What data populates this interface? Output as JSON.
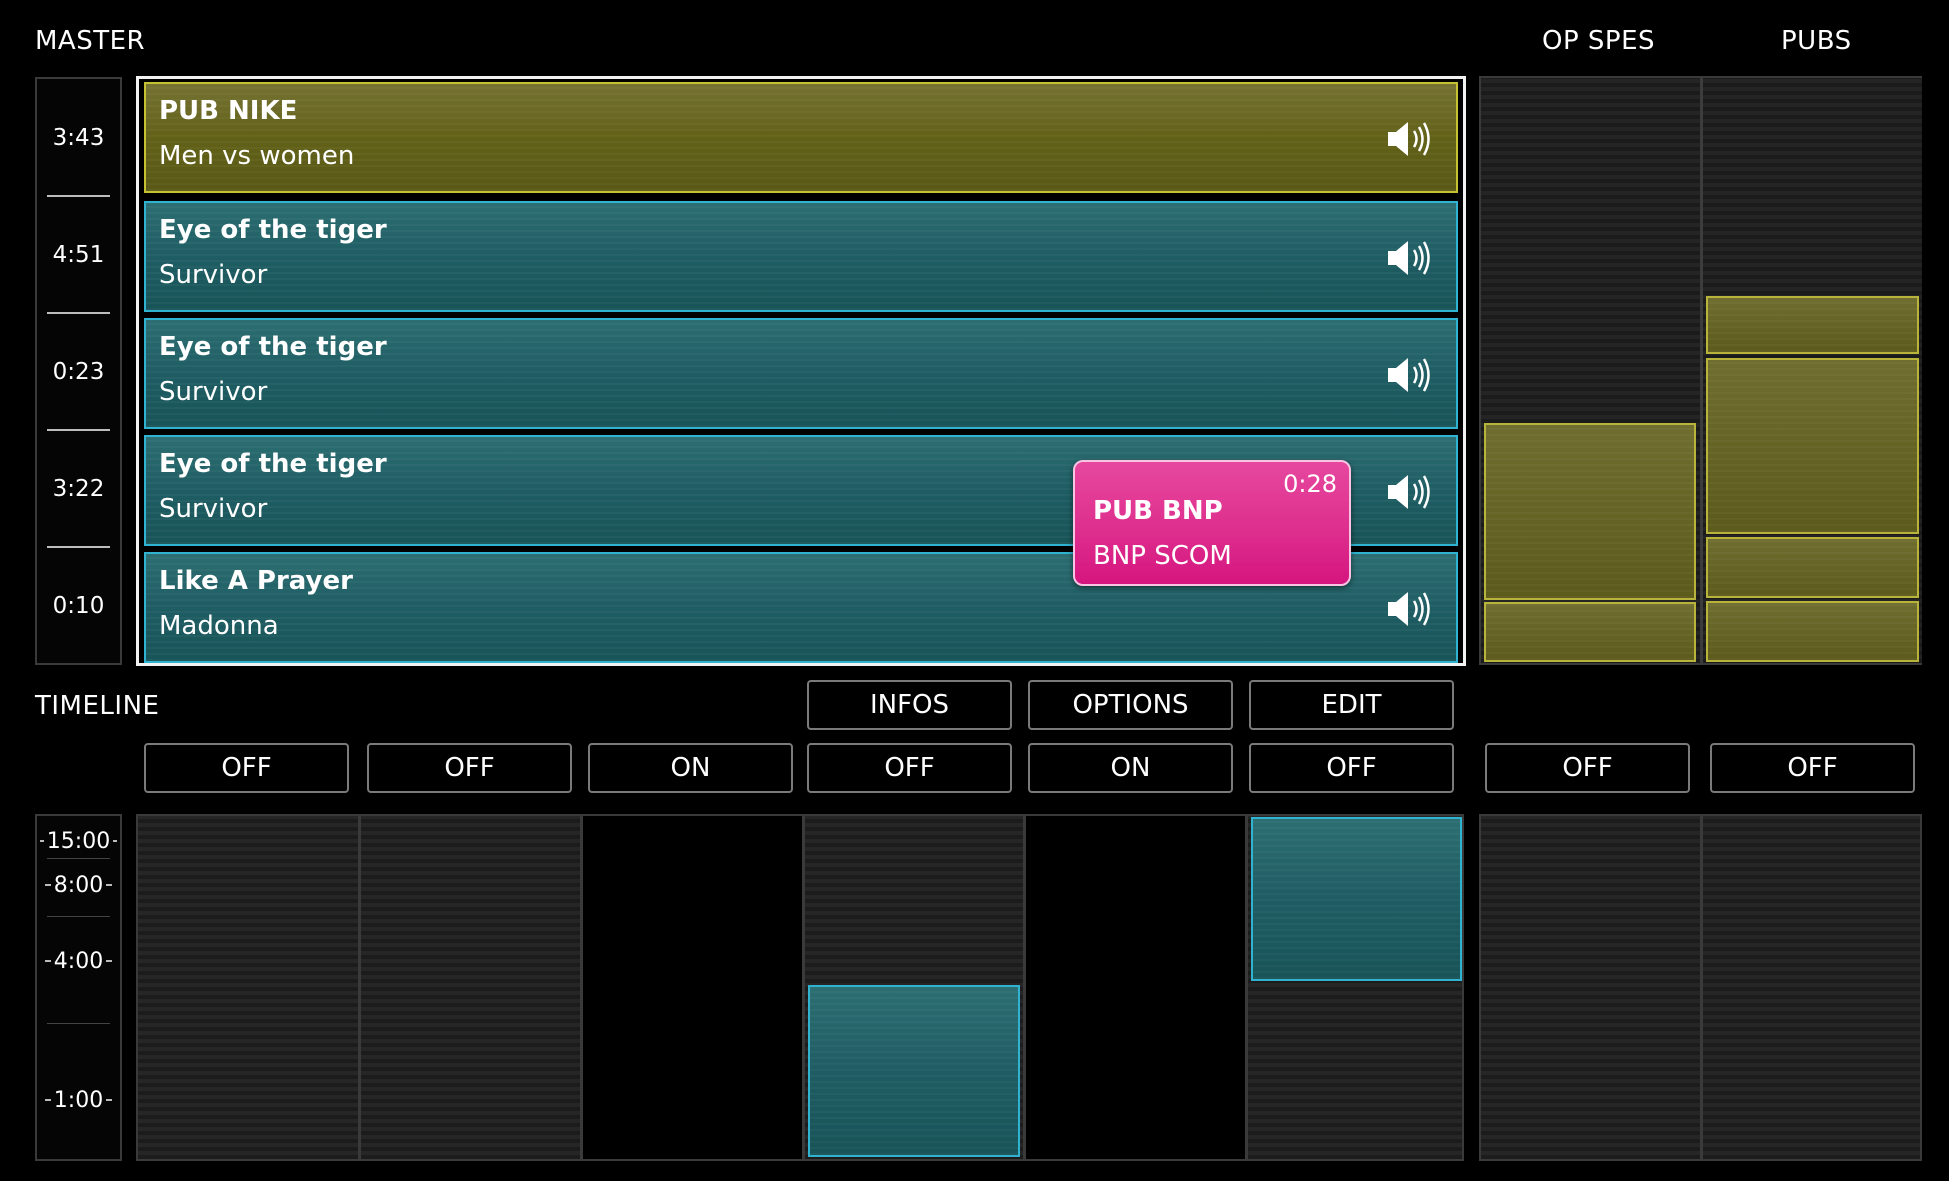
{
  "labels": {
    "master": "MASTER",
    "op_spes": "OP SPES",
    "pubs": "PUBS",
    "timeline": "TIMELINE"
  },
  "master_times": [
    "3:43",
    "4:51",
    "0:23",
    "3:22",
    "0:10"
  ],
  "tracks": [
    {
      "title": "PUB NIKE",
      "artist": "Men vs women",
      "kind": "pub"
    },
    {
      "title": "Eye of the tiger",
      "artist": "Survivor",
      "kind": "song"
    },
    {
      "title": "Eye of the tiger",
      "artist": "Survivor",
      "kind": "song"
    },
    {
      "title": "Eye of the tiger",
      "artist": "Survivor",
      "kind": "song"
    },
    {
      "title": "Like A Prayer",
      "artist": "Madonna",
      "kind": "song"
    }
  ],
  "popup": {
    "time": "0:28",
    "title": "PUB BNP",
    "subtitle": "BNP SCOM"
  },
  "menu": {
    "infos": "INFOS",
    "options": "OPTIONS",
    "edit": "EDIT"
  },
  "toggles": [
    "OFF",
    "OFF",
    "ON",
    "OFF",
    "ON",
    "OFF",
    "OFF",
    "OFF"
  ],
  "timeline_scale": [
    "15:00",
    "8:00",
    "4:00",
    "1:00"
  ],
  "icons": {
    "speaker": "speaker-icon"
  },
  "colors": {
    "song": "#1e5d63",
    "song_border": "#2fb3d1",
    "pub": "#626118",
    "pub_border": "#c6c033",
    "popup": "#de2f8e"
  }
}
